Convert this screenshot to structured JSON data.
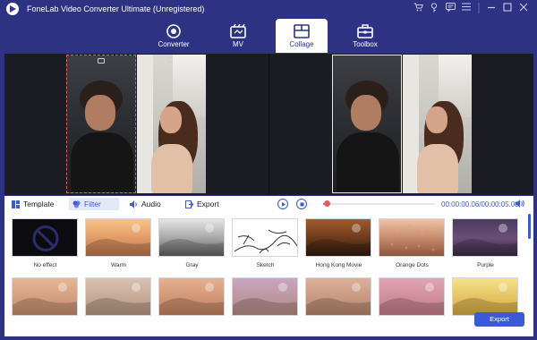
{
  "app": {
    "title": "FoneLab Video Converter Ultimate (Unregistered)"
  },
  "title_icons": [
    "cart-icon",
    "key-icon",
    "chat-icon",
    "menu-icon",
    "minimize-icon",
    "maximize-icon",
    "close-icon"
  ],
  "nav": {
    "tabs": [
      {
        "label": "Converter",
        "icon": "converter-icon"
      },
      {
        "label": "MV",
        "icon": "mv-icon"
      },
      {
        "label": "Collage",
        "icon": "collage-icon"
      },
      {
        "label": "Toolbox",
        "icon": "toolbox-icon"
      }
    ],
    "active": "Collage"
  },
  "toolbar": {
    "template_label": "Template",
    "filter_label": "Filter",
    "audio_label": "Audio",
    "export_label": "Export",
    "time_display": "00:00:00.06/00:00:05.00",
    "progress": 0.02
  },
  "filters": {
    "row1": [
      "No effect",
      "Warm",
      "Gray",
      "Sketch",
      "Hong Kong Movie",
      "Orange Dots",
      "Purple"
    ],
    "row2": [
      "",
      "",
      "",
      "",
      "",
      "",
      ""
    ]
  },
  "footer": {
    "export_button": "Export"
  },
  "colors": {
    "accent": "#3b5bd6",
    "titlebar": "#2d3282",
    "progress": "#e25d5d"
  }
}
